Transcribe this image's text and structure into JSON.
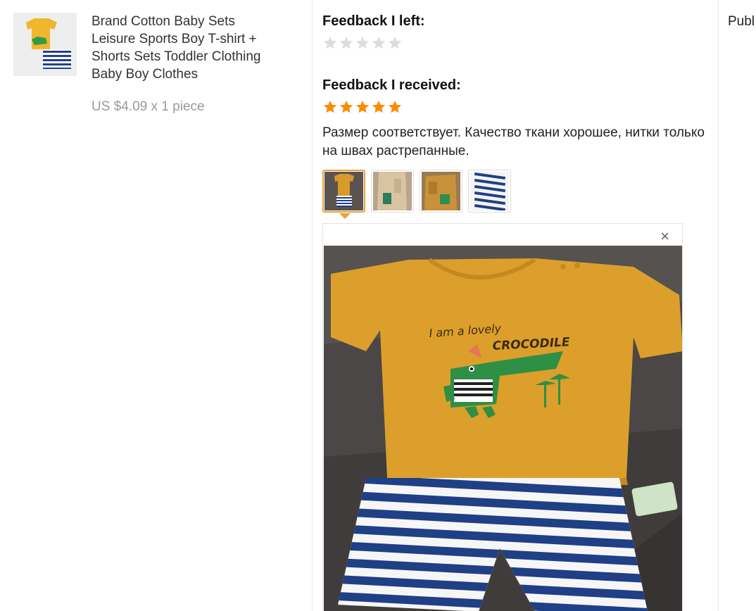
{
  "product": {
    "thumbnail_icon": "baby-clothes-set-photo",
    "title": "Brand Cotton Baby Sets Leisure Sports Boy T-shirt + Shorts Sets Toddler Clothing Baby Boy Clothes",
    "price": "US $4.09 x 1 piece"
  },
  "feedback_left": {
    "heading": "Feedback I left:",
    "rating": 0,
    "max_rating": 5
  },
  "feedback_received": {
    "heading": "Feedback I received:",
    "rating": 5,
    "max_rating": 5,
    "text": "Размер соответствует. Качество ткани хорошее, нитки только на швах растрепанные.",
    "photos": [
      {
        "name": "photo-1",
        "active": true
      },
      {
        "name": "photo-2",
        "active": false
      },
      {
        "name": "photo-3",
        "active": false
      },
      {
        "name": "photo-4",
        "active": false
      }
    ],
    "preview": {
      "close_label": "×",
      "shirt_text_line1": "I am a lovely",
      "shirt_text_line2": "CROCODILE"
    }
  },
  "next_column": {
    "label": "Publ"
  },
  "colors": {
    "star_filled": "#ff8a00",
    "star_empty": "#dddddd",
    "active_border": "#e6a23c",
    "shirt": "#e0a32e",
    "stripe_blue": "#1f3f86"
  }
}
